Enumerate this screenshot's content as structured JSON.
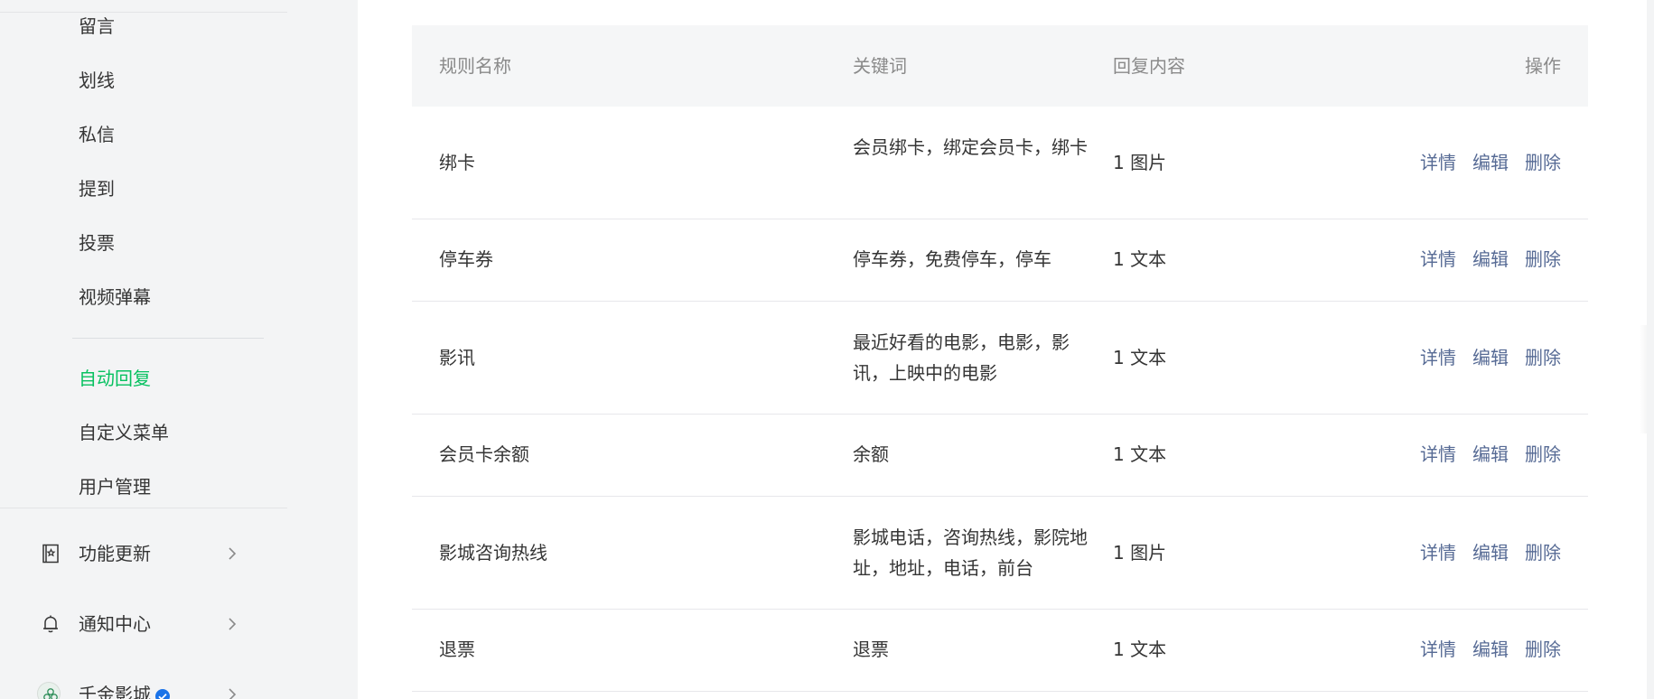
{
  "sidebar": {
    "sub_items": [
      {
        "label": "留言"
      },
      {
        "label": "划线"
      },
      {
        "label": "私信"
      },
      {
        "label": "提到"
      },
      {
        "label": "投票"
      },
      {
        "label": "视频弹幕"
      },
      {
        "label": "自动回复",
        "active": true
      },
      {
        "label": "自定义菜单"
      },
      {
        "label": "用户管理"
      }
    ],
    "groups": [
      {
        "label": "功能更新",
        "icon": "book-icon"
      },
      {
        "label": "通知中心",
        "icon": "bell-icon"
      },
      {
        "label": "千金影城",
        "icon": "account-avatar",
        "verified": true
      }
    ]
  },
  "table": {
    "headers": {
      "name": "规则名称",
      "keywords": "关键词",
      "reply": "回复内容",
      "ops": "操作"
    },
    "ops_labels": {
      "detail": "详情",
      "edit": "编辑",
      "delete": "删除"
    },
    "rows": [
      {
        "name": "绑卡",
        "keywords": "会员绑卡，绑定会员卡，绑卡",
        "reply": "1 图片"
      },
      {
        "name": "停车券",
        "keywords": "停车券，免费停车，停车",
        "reply": "1 文本"
      },
      {
        "name": "影讯",
        "keywords": "最近好看的电影，电影，影讯，上映中的电影",
        "reply": "1 文本"
      },
      {
        "name": "会员卡余额",
        "keywords": "余额",
        "reply": "1 文本"
      },
      {
        "name": "影城咨询热线",
        "keywords": "影城电话，咨询热线，影院地址，地址，电话，前台",
        "reply": "1 图片"
      },
      {
        "name": "退票",
        "keywords": "退票",
        "reply": "1 文本"
      }
    ]
  },
  "colors": {
    "accent_green": "#07c160",
    "link_blue": "#576b95",
    "sidebar_bg": "#f3f4f5"
  }
}
